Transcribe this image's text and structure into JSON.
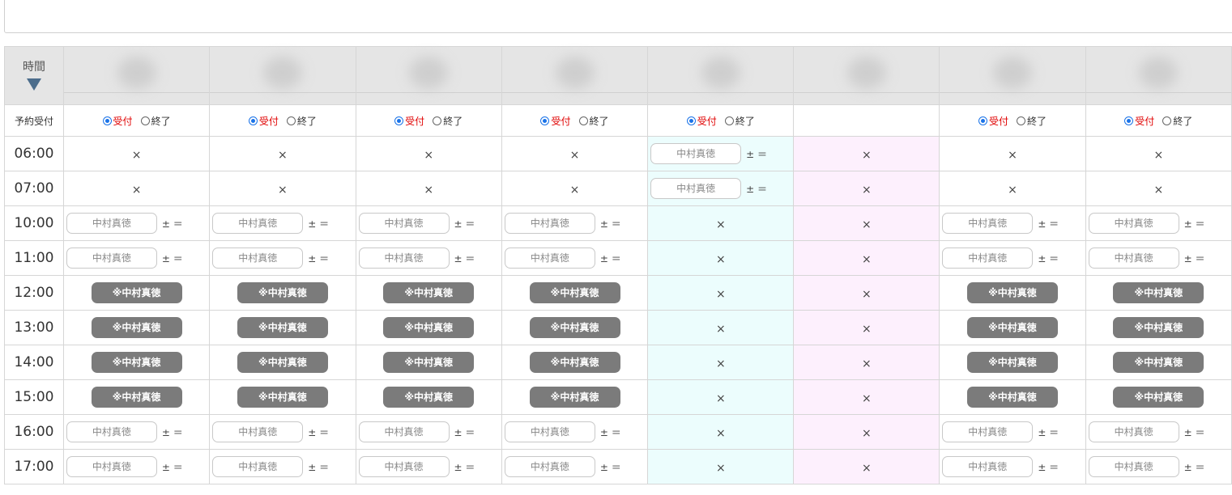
{
  "colors": {
    "cyan_column": "#ecfdfd",
    "pink_column": "#fdf0fd",
    "booked": "#7b7b7b",
    "accept_text": "#e00000"
  },
  "header": {
    "time_label": "時間",
    "sort_icon": "triangle-down-icon",
    "columns": [
      "",
      "",
      "",
      "",
      "",
      "",
      "",
      ""
    ]
  },
  "accept_row": {
    "label": "予約受付",
    "accept_label": "受付",
    "end_label": "終了",
    "columns": [
      true,
      true,
      true,
      true,
      true,
      false,
      true,
      true
    ]
  },
  "cell_texts": {
    "name": "中村真徳",
    "booked": "※中村真徳",
    "closed": "×",
    "adjust": "± ＝"
  },
  "rows": [
    {
      "time": "06:00",
      "cells": [
        "x",
        "x",
        "x",
        "x",
        "input",
        "x",
        "x",
        "x"
      ]
    },
    {
      "time": "07:00",
      "cells": [
        "x",
        "x",
        "x",
        "x",
        "input",
        "x",
        "x",
        "x"
      ]
    },
    {
      "time": "10:00",
      "cells": [
        "input",
        "input",
        "input",
        "input",
        "x",
        "x",
        "input",
        "input"
      ]
    },
    {
      "time": "11:00",
      "cells": [
        "input",
        "input",
        "input",
        "input",
        "x",
        "x",
        "input",
        "input"
      ]
    },
    {
      "time": "12:00",
      "cells": [
        "booked",
        "booked",
        "booked",
        "booked",
        "x",
        "x",
        "booked",
        "booked"
      ]
    },
    {
      "time": "13:00",
      "cells": [
        "booked",
        "booked",
        "booked",
        "booked",
        "x",
        "x",
        "booked",
        "booked"
      ]
    },
    {
      "time": "14:00",
      "cells": [
        "booked",
        "booked",
        "booked",
        "booked",
        "x",
        "x",
        "booked",
        "booked"
      ]
    },
    {
      "time": "15:00",
      "cells": [
        "booked",
        "booked",
        "booked",
        "booked",
        "x",
        "x",
        "booked",
        "booked"
      ]
    },
    {
      "time": "16:00",
      "cells": [
        "input",
        "input",
        "input",
        "input",
        "x",
        "x",
        "input",
        "input"
      ]
    },
    {
      "time": "17:00",
      "cells": [
        "input",
        "input",
        "input",
        "input",
        "x",
        "x",
        "input",
        "input"
      ]
    }
  ],
  "column_tint": [
    "",
    "",
    "",
    "",
    "cyan",
    "pink",
    "",
    ""
  ]
}
